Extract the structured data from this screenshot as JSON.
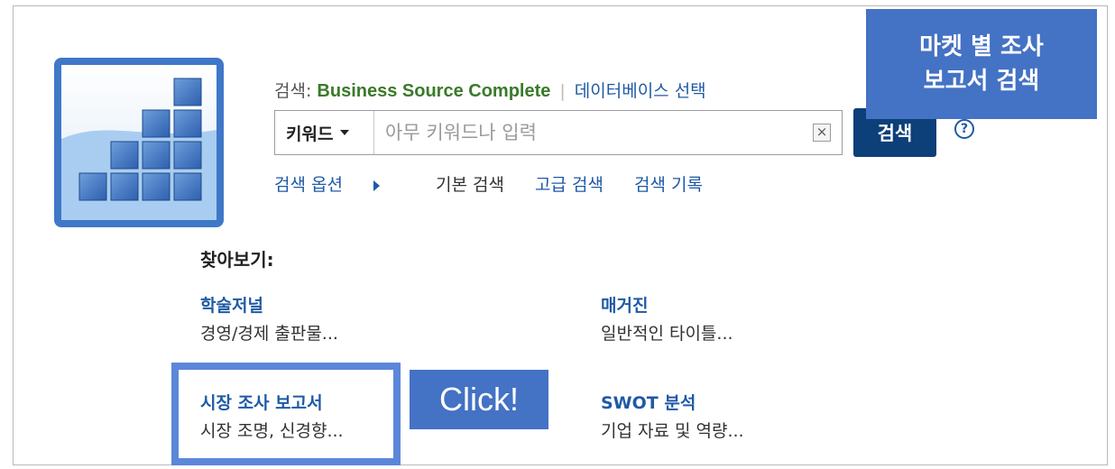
{
  "search": {
    "label": "검색: ",
    "database": "Business Source Complete",
    "choose_db": "데이터베이스 선택",
    "field_select": "키워드",
    "placeholder": "아무 키워드나 입력",
    "clear": "×",
    "button": "검색",
    "help": "?"
  },
  "options": {
    "search_options": "검색 옵션",
    "basic": "기본 검색",
    "advanced": "고급 검색",
    "history": "검색 기록"
  },
  "browse": {
    "label": "찾아보기:",
    "items": [
      {
        "title": "학술저널",
        "desc": "경영/경제 출판물..."
      },
      {
        "title": "매거진",
        "desc": "일반적인 타이틀..."
      },
      {
        "title": "시장 조사 보고서",
        "desc": "시장 조명, 신경향..."
      },
      {
        "title": "SWOT 분석",
        "desc": "기업 자료 및 역량..."
      }
    ]
  },
  "annotations": {
    "callout_line1": "마켓 별 조사",
    "callout_line2": "보고서 검색",
    "click": "Click!"
  },
  "colors": {
    "link": "#1f5aa6",
    "database": "#3a7a2a",
    "search_button": "#0d3f78",
    "annotation": "#4472c4"
  }
}
